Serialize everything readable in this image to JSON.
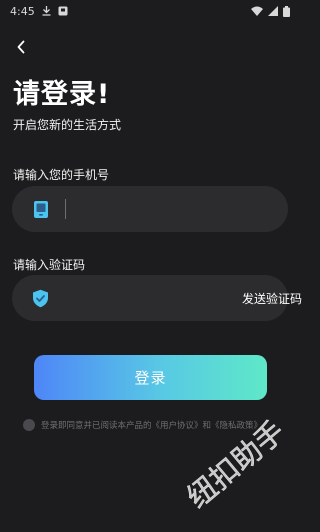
{
  "status_bar": {
    "time": "4:45",
    "icons": [
      "download-icon",
      "notification-icon",
      "wifi-icon",
      "signal-icon",
      "battery-icon"
    ]
  },
  "header": {
    "back_icon": "chevron-left-icon",
    "title": "请登录!",
    "subtitle": "开启您新的生活方式"
  },
  "phone_field": {
    "label": "请输入您的手机号",
    "icon": "phone-icon",
    "value": "",
    "placeholder": ""
  },
  "code_field": {
    "label": "请输入验证码",
    "icon": "shield-check-icon",
    "value": "",
    "placeholder": "",
    "send_code_label": "发送验证码"
  },
  "login_button": {
    "label": "登录"
  },
  "agreement": {
    "prefix": "登录即同意并已阅读本产品的",
    "user_agreement": "《用户协议》",
    "and": "和",
    "privacy_policy": "《隐私政策》",
    "checked": false
  },
  "watermark": {
    "text": "纽扣助手"
  },
  "colors": {
    "background": "#1c1c1e",
    "input_background": "#2c2c2e",
    "phone_icon": "#4cc4f0",
    "shield_icon": "#4cc4f0",
    "button_gradient_start": "#4e86f8",
    "button_gradient_end": "#5ee8c8"
  }
}
